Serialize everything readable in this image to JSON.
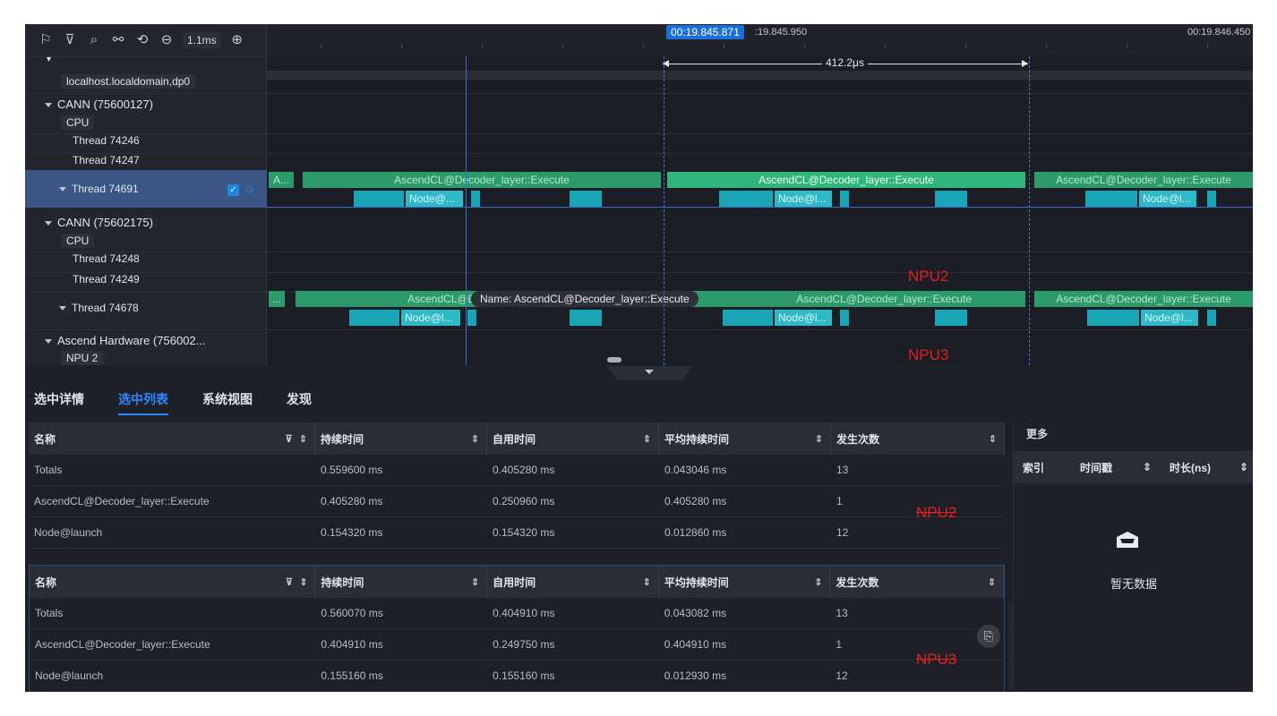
{
  "toolbar": {
    "icons": [
      "flag-icon",
      "filter-icon",
      "search-icon",
      "link-icon",
      "reset-icon",
      "zoom-out-icon",
      "zoom-in-icon"
    ],
    "zoom_level": "1.1ms"
  },
  "ruler": {
    "cursor_time": "00:19.845.871",
    "start_time": ":19.845.950",
    "end_time": "00:19.846.450",
    "measure_duration": "412.2μs"
  },
  "tree": {
    "host": "localhost.localdomain,dp0",
    "proc1": "CANN (75600127)",
    "proc1_cpu": "CPU",
    "thread_74246": "Thread 74246",
    "thread_74247": "Thread 74247",
    "thread_74691": "Thread 74691",
    "proc2": "CANN (75602175)",
    "proc2_cpu": "CPU",
    "thread_74248": "Thread 74248",
    "thread_74249": "Thread 74249",
    "thread_74678": "Thread 74678",
    "proc3": "Ascend Hardware (756002...",
    "proc3_npu": "NPU 2"
  },
  "tracks": {
    "short_a": "A...",
    "ellipsis": "...",
    "execute": "AscendCL@Decoder_layer::Execute",
    "execute_cut": "AscendCL@Dec",
    "node_a": "Node@...",
    "node_b": "Node@l...",
    "tooltip": "Name:  AscendCL@Decoder_layer::Execute",
    "npu2": "NPU2",
    "npu3": "NPU3"
  },
  "bottom_tabs": [
    "选中详情",
    "选中列表",
    "系统视图",
    "发现"
  ],
  "table_headers": [
    "名称",
    "持续时间",
    "自用时间",
    "平均持续时间",
    "发生次数"
  ],
  "table_npu2": [
    [
      "Totals",
      "0.559600 ms",
      "0.405280 ms",
      "0.043046 ms",
      "13"
    ],
    [
      "AscendCL@Decoder_layer::Execute",
      "0.405280 ms",
      "0.250960 ms",
      "0.405280 ms",
      "1"
    ],
    [
      "Node@launch",
      "0.154320 ms",
      "0.154320 ms",
      "0.012860 ms",
      "12"
    ]
  ],
  "table_npu3": [
    [
      "Totals",
      "0.560070 ms",
      "0.404910 ms",
      "0.043082 ms",
      "13"
    ],
    [
      "AscendCL@Decoder_layer::Execute",
      "0.404910 ms",
      "0.249750 ms",
      "0.404910 ms",
      "1"
    ],
    [
      "Node@launch",
      "0.155160 ms",
      "0.155160 ms",
      "0.012930 ms",
      "12"
    ]
  ],
  "annotations": {
    "npu2": "NPU2",
    "npu3": "NPU3"
  },
  "more": {
    "title": "更多",
    "headers": [
      "索引",
      "时间戳",
      "时长(ns)"
    ],
    "empty_text": "暂无数据"
  },
  "colors": {
    "accent": "#2f88ff",
    "bar_green": "#2c9a6a",
    "bar_cyan": "#1aa5b6",
    "annotation_red": "#e02020"
  }
}
